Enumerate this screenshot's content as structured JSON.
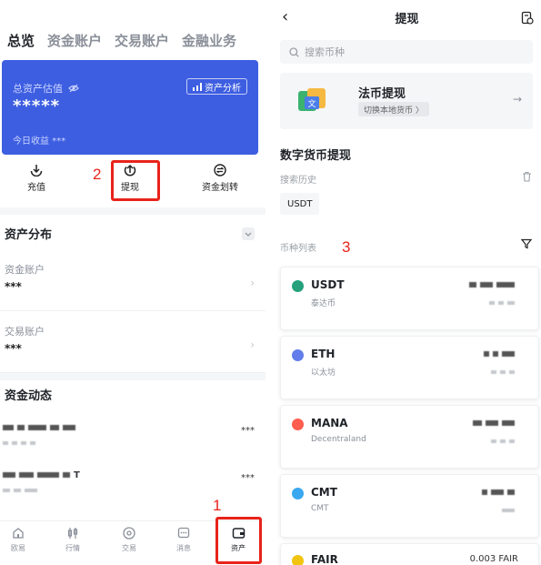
{
  "left": {
    "tabs": [
      "总览",
      "资金账户",
      "交易账户",
      "金融业务"
    ],
    "asset_card": {
      "label": "总资产估值",
      "value": "*****",
      "analysis_label": "资产分析",
      "earnings_label": "今日收益",
      "earnings_value": "***"
    },
    "actions": {
      "deposit": "充值",
      "withdraw": "提现",
      "transfer": "资金划转"
    },
    "distribution": {
      "title": "资产分布",
      "accounts": [
        {
          "name": "资金账户",
          "value": "***"
        },
        {
          "name": "交易账户",
          "value": "***"
        }
      ]
    },
    "flows": {
      "title": "资金动态",
      "rows": [
        {
          "amount": "***"
        },
        {
          "suffix": "T",
          "amount": "***"
        }
      ]
    },
    "bottom_nav": [
      "欧易",
      "行情",
      "交易",
      "消息",
      "资产"
    ]
  },
  "right": {
    "title": "提现",
    "search_placeholder": "搜索币种",
    "fiat": {
      "title": "法币提现",
      "switch_label": "切换本地货币 〉"
    },
    "crypto_title": "数字货币提现",
    "history_label": "搜索历史",
    "history_items": [
      "USDT"
    ],
    "list_label": "币种列表",
    "coins": [
      {
        "symbol": "USDT",
        "name": "泰达币",
        "color": "#26a17b"
      },
      {
        "symbol": "ETH",
        "name": "以太坊",
        "color": "#627eea"
      },
      {
        "symbol": "MANA",
        "name": "Decentraland",
        "color": "#ff5d4e"
      },
      {
        "symbol": "CMT",
        "name": "CMT",
        "color": "#3aa8f0"
      },
      {
        "symbol": "FAIR",
        "amount": "0.003 FAIR",
        "color": "#f1c40f"
      }
    ]
  },
  "annotations": {
    "step1": "1",
    "step2": "2",
    "step3": "3"
  },
  "colors": {
    "brand_blue": "#3d5ee1",
    "annotation_red": "#e8231b"
  }
}
